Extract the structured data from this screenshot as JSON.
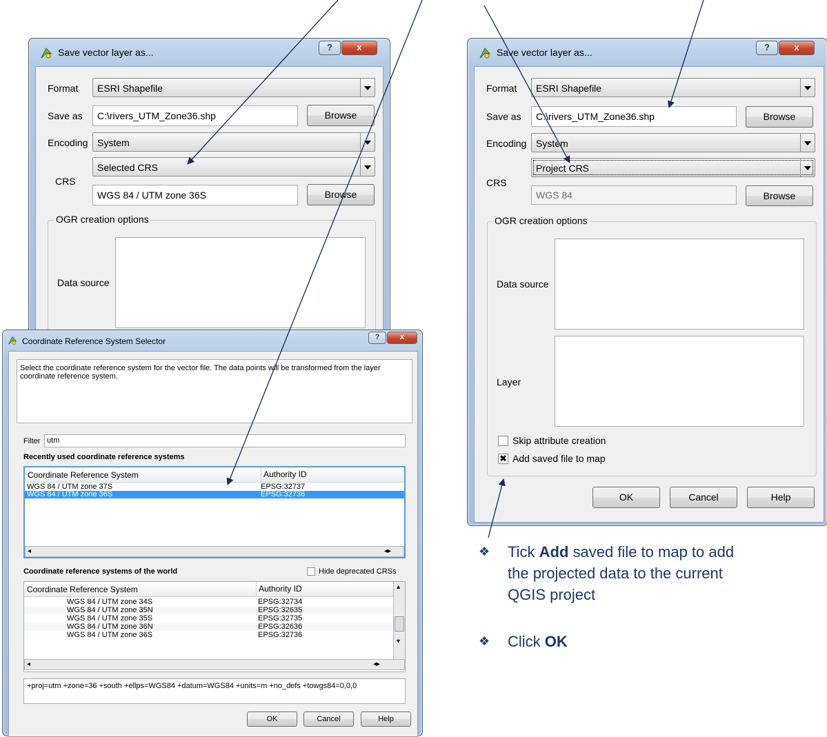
{
  "left_dialog": {
    "title": "Save vector layer as...",
    "help_glyph": "?",
    "close_glyph": "x",
    "format_label": "Format",
    "format_value": "ESRI Shapefile",
    "save_as_label": "Save as",
    "save_as_value": "C:\\rivers_UTM_Zone36.shp",
    "browse_label": "Browse",
    "encoding_label": "Encoding",
    "encoding_value": "System",
    "crs_label": "CRS",
    "crs_mode_value": "Selected CRS",
    "crs_value": "WGS 84 / UTM zone 36S",
    "crs_browse_label": "Browse",
    "ogr_group_title": "OGR creation options",
    "data_source_label": "Data source"
  },
  "crs_selector": {
    "title": "Coordinate Reference System Selector",
    "help_glyph": "?",
    "close_glyph": "x",
    "description": "Select the coordinate reference system for the vector file. The data points will be transformed from the layer coordinate reference system.",
    "filter_label": "Filter",
    "filter_value": "utm",
    "recent_heading": "Recently used coordinate reference systems",
    "col_crs": "Coordinate Reference System",
    "col_auth": "Authority ID",
    "recent_rows": [
      {
        "crs": "WGS 84 / UTM zone 37S",
        "auth": "EPSG:32737"
      },
      {
        "crs": "WGS 84 / UTM zone 36S",
        "auth": "EPSG:32736"
      }
    ],
    "world_heading": "Coordinate reference systems of the world",
    "hide_deprecated_label": "Hide deprecated CRSs",
    "world_rows": [
      {
        "crs": "WGS 84 / UTM zone 34S",
        "auth": "EPSG:32734"
      },
      {
        "crs": "WGS 84 / UTM zone 35N",
        "auth": "EPSG:32635"
      },
      {
        "crs": "WGS 84 / UTM zone 35S",
        "auth": "EPSG:32735"
      },
      {
        "crs": "WGS 84 / UTM zone 36N",
        "auth": "EPSG:32636"
      },
      {
        "crs": "WGS 84 / UTM zone 36S",
        "auth": "EPSG:32736"
      }
    ],
    "proj_string": "+proj=utm +zone=36 +south +ellps=WGS84 +datum=WGS84 +units=m +no_defs +towgs84=0,0,0",
    "ok_label": "OK",
    "cancel_label": "Cancel",
    "help_label": "Help"
  },
  "right_dialog": {
    "title": "Save vector layer as...",
    "help_glyph": "?",
    "close_glyph": "x",
    "format_label": "Format",
    "format_value": "ESRI Shapefile",
    "save_as_label": "Save as",
    "save_as_value": "C:\\rivers_UTM_Zone36.shp",
    "browse_label": "Browse",
    "encoding_label": "Encoding",
    "encoding_value": "System",
    "crs_label": "CRS",
    "crs_mode_value": "Project CRS",
    "crs_value": "WGS 84",
    "crs_browse_label": "Browse",
    "ogr_group_title": "OGR creation options",
    "data_source_label": "Data source",
    "layer_label": "Layer",
    "skip_attr_label": "Skip attribute creation",
    "add_saved_label": "Add saved file to map",
    "add_saved_checked_glyph": "✖",
    "ok_label": "OK",
    "cancel_label": "Cancel",
    "help_label": "Help"
  },
  "notes": {
    "bullet_glyph": "❖",
    "tick_pre": "Tick ",
    "tick_bold": "Add",
    "tick_post": " saved file to map to add",
    "tick_line2": "the projected data to the current",
    "tick_line3": "QGIS project",
    "click_pre": "Click ",
    "click_bold": "OK"
  },
  "colors": {
    "selection": "#3399ff",
    "note_text": "#1f3864",
    "close_button": "#c7452b",
    "arrow": "#1a2a55"
  }
}
